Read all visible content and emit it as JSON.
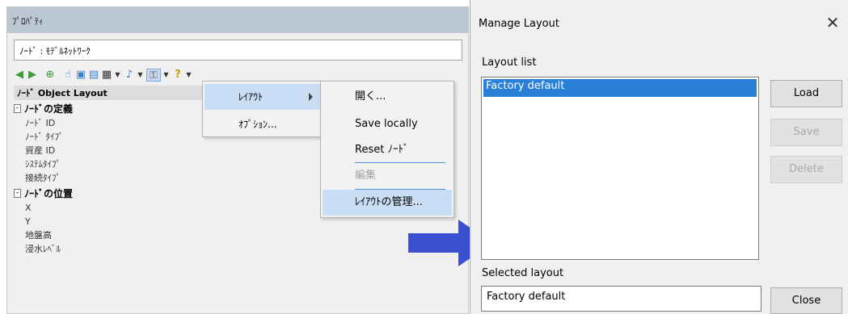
{
  "property_panel": {
    "title": "ﾌﾟﾛﾊﾟﾃｨ",
    "node_name": "ﾉｰﾄﾞ : ﾓﾃﾞﾙﾈｯﾄﾜｰｸ",
    "column_header": "ﾉｰﾄﾞ Object Layout",
    "groups": [
      {
        "label": "ﾉｰﾄﾞの定義",
        "expander": "-",
        "items": [
          "ﾉｰﾄﾞ ID",
          "ﾉｰﾄﾞ ﾀｲﾌﾟ",
          "資産 ID",
          "ｼｽﾃﾑﾀｲﾌﾟ",
          "接続ﾀｲﾌﾟ"
        ]
      },
      {
        "label": "ﾉｰﾄﾞの位置",
        "expander": "-",
        "items": [
          "X",
          "Y",
          "地盤高",
          "浸水ﾚﾍﾞﾙ"
        ]
      }
    ]
  },
  "toolbar": {
    "icons": [
      {
        "glyph": "◀",
        "color": "#3a9a3a"
      },
      {
        "glyph": "▶",
        "color": "#3a9a3a"
      },
      {
        "glyph": "⊕",
        "color": "#3a9a3a"
      },
      {
        "glyph": "☝",
        "color": "#3a7fd0"
      },
      {
        "glyph": "▣",
        "color": "#3a7fd0"
      },
      {
        "glyph": "▤",
        "color": "#3a7fd0"
      },
      {
        "glyph": "▦",
        "color": "#333333"
      },
      {
        "glyph": "♪",
        "color": "#3a7fd0"
      },
      {
        "glyph": "⚿",
        "color": "#555555"
      },
      {
        "glyph": "?",
        "color": "#c0a000"
      }
    ]
  },
  "menu1": {
    "layout": "ﾚｲｱｳﾄ",
    "options": "ｵﾌﾟｼｮﾝ..."
  },
  "menu2": {
    "open": "開く...",
    "save_locally": "Save locally",
    "reset": "Reset ﾉｰﾄﾞ",
    "edit": "編集",
    "manage": "ﾚｲｱｳﾄの管理..."
  },
  "dialog": {
    "title": "Manage Layout",
    "close_glyph": "✕",
    "layout_list_label": "Layout list",
    "list_items": [
      "Factory default"
    ],
    "load": "Load",
    "save": "Save",
    "delete": "Delete",
    "selected_layout_label": "Selected layout",
    "selected_layout_value": "Factory default",
    "close": "Close"
  },
  "colors": {
    "selection": "#2a7fd6",
    "menu_highlight": "#c9def5",
    "arrow": "#3a4fcf",
    "title_bar": "#bcc7d6"
  }
}
